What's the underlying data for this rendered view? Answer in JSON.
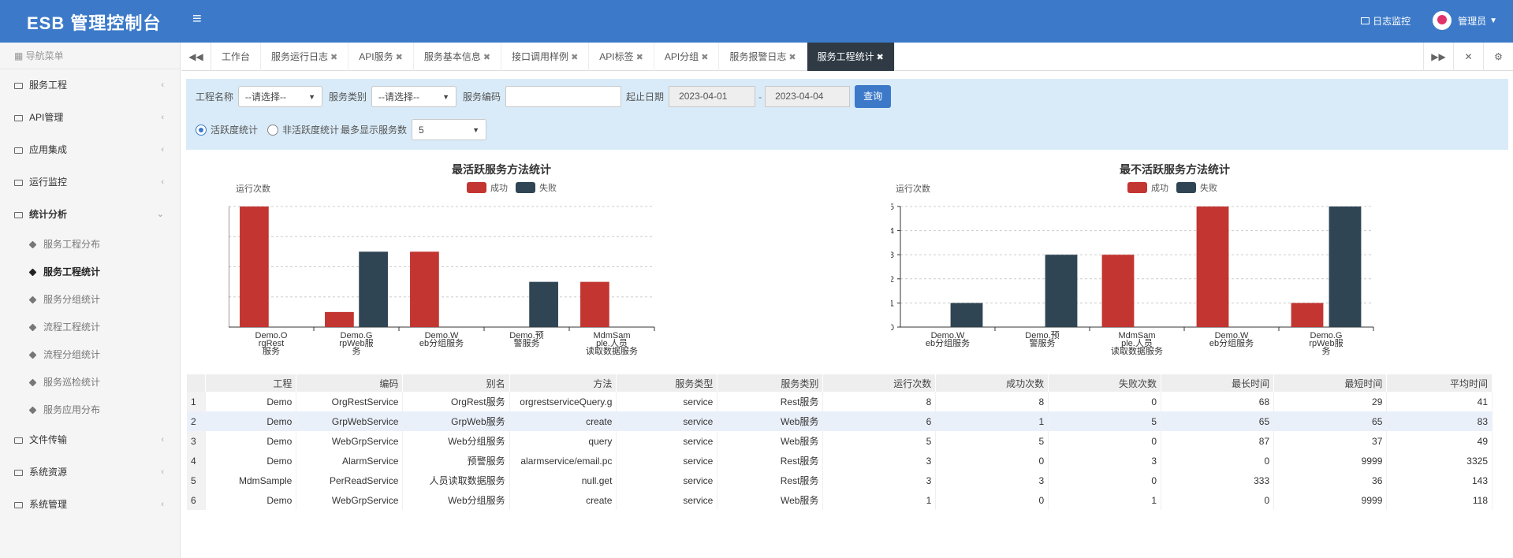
{
  "app": {
    "title": "ESB 管理控制台",
    "menu_toggle": "≡"
  },
  "topbar": {
    "log_monitor": "日志监控",
    "user": "管理员"
  },
  "sidebar": {
    "header": "导航菜单",
    "items": [
      {
        "label": "服务工程"
      },
      {
        "label": "API管理"
      },
      {
        "label": "应用集成"
      },
      {
        "label": "运行监控"
      },
      {
        "label": "统计分析"
      },
      {
        "label": "文件传输"
      },
      {
        "label": "系统资源"
      },
      {
        "label": "系统管理"
      }
    ],
    "sub_items": [
      {
        "label": "服务工程分布"
      },
      {
        "label": "服务工程统计"
      },
      {
        "label": "服务分组统计"
      },
      {
        "label": "流程工程统计"
      },
      {
        "label": "流程分组统计"
      },
      {
        "label": "服务巡检统计"
      },
      {
        "label": "服务应用分布"
      }
    ]
  },
  "tabs": [
    {
      "label": "工作台",
      "closable": false
    },
    {
      "label": "服务运行日志",
      "closable": true
    },
    {
      "label": "API服务",
      "closable": true
    },
    {
      "label": "服务基本信息",
      "closable": true
    },
    {
      "label": "接口调用样例",
      "closable": true
    },
    {
      "label": "API标签",
      "closable": true
    },
    {
      "label": "API分组",
      "closable": true
    },
    {
      "label": "服务报警日志",
      "closable": true
    },
    {
      "label": "服务工程统计",
      "closable": true,
      "active": true
    }
  ],
  "filter": {
    "project_label": "工程名称",
    "project_value": "--请选择--",
    "category_label": "服务类别",
    "category_value": "--请选择--",
    "code_label": "服务编码",
    "code_value": "",
    "date_label": "起止日期",
    "date_from": "2023-04-01",
    "date_sep": "-",
    "date_to": "2023-04-04",
    "query_button": "查询",
    "radio_active": "活跃度统计",
    "radio_inactive": "非活跃度统计",
    "max_label": "最多显示服务数",
    "max_value": "5"
  },
  "legend": {
    "success": "成功",
    "fail": "失败"
  },
  "colors": {
    "success": "#c23531",
    "fail": "#2f4554",
    "header": "#3c7ac9"
  },
  "chart_data": [
    {
      "type": "bar",
      "title": "最活跃服务方法统计",
      "ylabel": "运行次数",
      "ylim": [
        0,
        8
      ],
      "yticks": [
        0,
        2,
        4,
        6,
        8
      ],
      "categories": [
        [
          "Demo.O",
          "rgRest",
          "服务"
        ],
        [
          "Demo.G",
          "rpWeb服",
          "务"
        ],
        [
          "Demo.W",
          "eb分组服务"
        ],
        [
          "Demo.预",
          "警服务"
        ],
        [
          "MdmSam",
          "ple.人员",
          "读取数据服务"
        ]
      ],
      "series": [
        {
          "name": "成功",
          "values": [
            8,
            1,
            5,
            0,
            3
          ]
        },
        {
          "name": "失败",
          "values": [
            0,
            5,
            0,
            3,
            0
          ]
        }
      ]
    },
    {
      "type": "bar",
      "title": "最不活跃服务方法统计",
      "ylabel": "运行次数",
      "ylim": [
        0,
        5
      ],
      "yticks": [
        0,
        1,
        2,
        3,
        4,
        5
      ],
      "categories": [
        [
          "Demo.W",
          "eb分组服务"
        ],
        [
          "Demo.预",
          "警服务"
        ],
        [
          "MdmSam",
          "ple.人员",
          "读取数据服务"
        ],
        [
          "Demo.W",
          "eb分组服务"
        ],
        [
          "Demo.G",
          "rpWeb服",
          "务"
        ]
      ],
      "series": [
        {
          "name": "成功",
          "values": [
            0,
            0,
            3,
            5,
            1
          ]
        },
        {
          "name": "失败",
          "values": [
            1,
            3,
            0,
            0,
            5
          ]
        }
      ]
    }
  ],
  "table": {
    "headers": [
      "",
      "工程",
      "编码",
      "别名",
      "方法",
      "服务类型",
      "服务类别",
      "运行次数",
      "成功次数",
      "失败次数",
      "最长时间",
      "最短时间",
      "平均时间"
    ],
    "rows": [
      [
        "1",
        "Demo",
        "OrgRestService",
        "OrgRest服务",
        "orgrestserviceQuery.g",
        "service",
        "Rest服务",
        "8",
        "8",
        "0",
        "68",
        "29",
        "41"
      ],
      [
        "2",
        "Demo",
        "GrpWebService",
        "GrpWeb服务",
        "create",
        "service",
        "Web服务",
        "6",
        "1",
        "5",
        "65",
        "65",
        "83"
      ],
      [
        "3",
        "Demo",
        "WebGrpService",
        "Web分组服务",
        "query",
        "service",
        "Web服务",
        "5",
        "5",
        "0",
        "87",
        "37",
        "49"
      ],
      [
        "4",
        "Demo",
        "AlarmService",
        "预警服务",
        "alarmservice/email.pc",
        "service",
        "Rest服务",
        "3",
        "0",
        "3",
        "0",
        "9999",
        "3325"
      ],
      [
        "5",
        "MdmSample",
        "PerReadService",
        "人员读取数据服务",
        "null.get",
        "service",
        "Rest服务",
        "3",
        "3",
        "0",
        "333",
        "36",
        "143"
      ],
      [
        "6",
        "Demo",
        "WebGrpService",
        "Web分组服务",
        "create",
        "service",
        "Web服务",
        "1",
        "0",
        "1",
        "0",
        "9999",
        "118"
      ]
    ]
  }
}
